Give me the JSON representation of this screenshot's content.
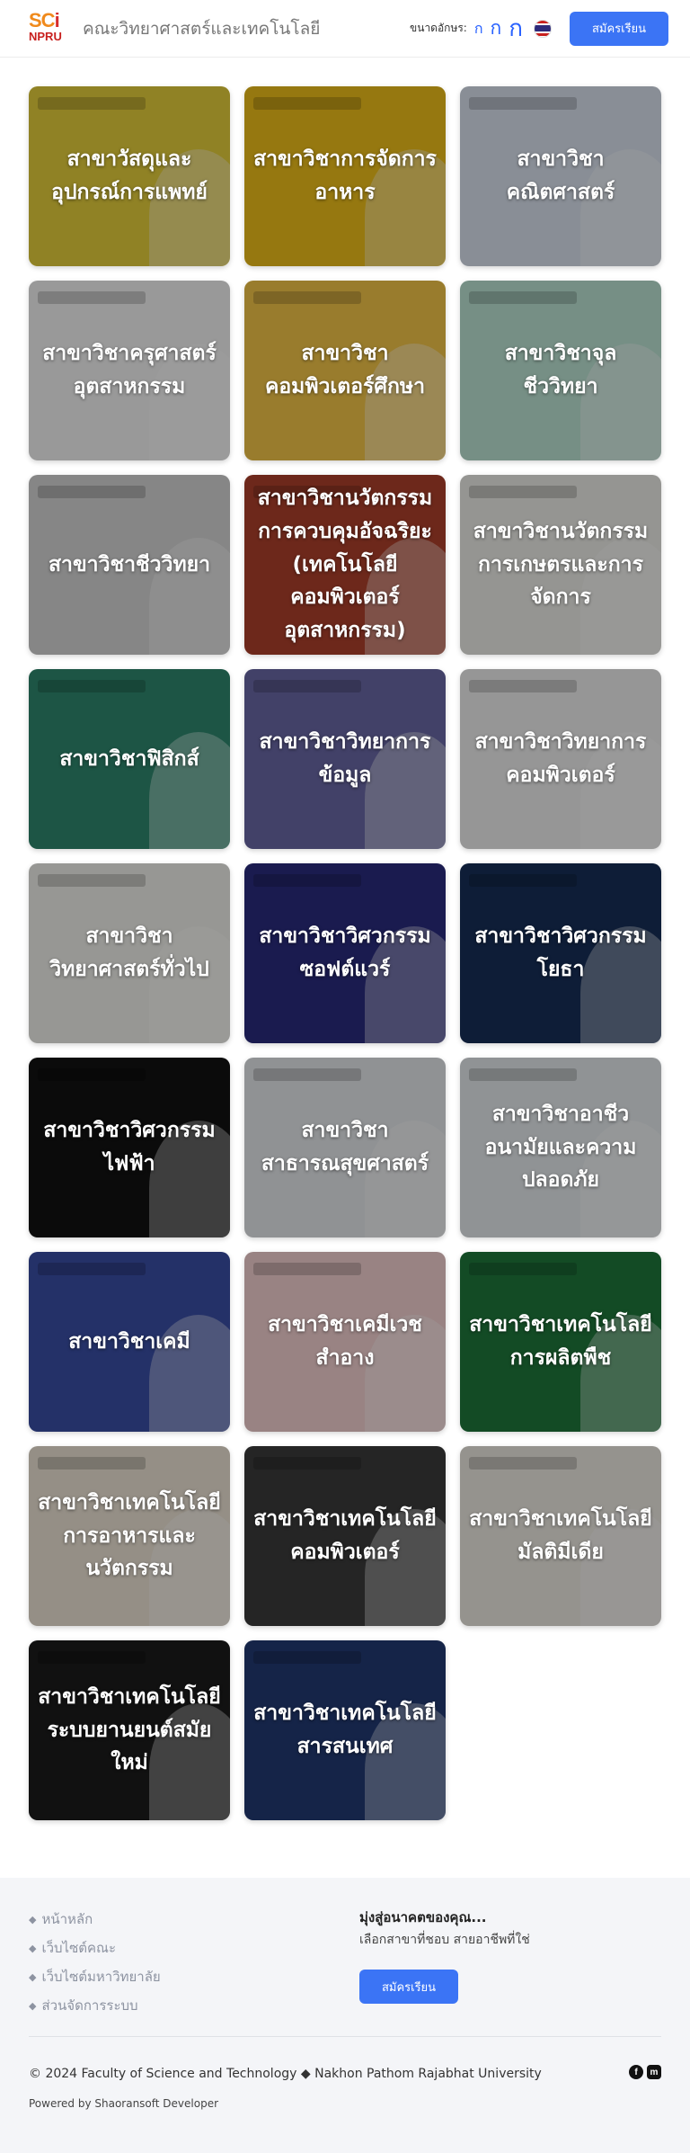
{
  "header": {
    "logo_sc": "SC",
    "logo_i": "i",
    "logo_npru": "NPRU",
    "site_title": "คณะวิทยาศาสตร์และเทคโนโลยี",
    "font_size_label": "ขนาดอักษร:",
    "font_small": "ก",
    "font_medium": "ก",
    "font_large": "ก",
    "language_flag": "thai-flag-icon",
    "apply_button": "สมัครเรียน"
  },
  "colors": {
    "primary": "#3b74f5",
    "link_muted": "#8d93a1",
    "footer_bg": "#f4f5f8"
  },
  "majors": [
    {
      "label": "สาขาวัสดุและอุปกรณ์การแพทย์",
      "bg": "#e9d23c"
    },
    {
      "label": "สาขาวิชาการจัดการอาหาร",
      "bg": "#f2c21b"
    },
    {
      "label": "สาขาวิชาคณิตศาสตร์",
      "bg": "#dde6f3"
    },
    {
      "label": "สาขาวิชาครุศาสตร์อุตสาหกรรม",
      "bg": "#f7f7f7"
    },
    {
      "label": "สาขาวิชาคอมพิวเตอร์ศึกษา",
      "bg": "#f7c84a"
    },
    {
      "label": "สาขาวิชาจุลชีววิทยา",
      "bg": "#bfe7d7"
    },
    {
      "label": "สาขาวิชาชีววิทยา",
      "bg": "#d9d9d9"
    },
    {
      "label": "สาขาวิชานวัตกรรมการควบคุมอัจฉริยะ (เทคโนโลยีคอมพิวเตอร์อุตสาหกรรม)",
      "bg": "#b1422c"
    },
    {
      "label": "สาขาวิชานวัตกรรมการเกษตรและการจัดการ",
      "bg": "#f1f1ec"
    },
    {
      "label": "สาขาวิชาฟิสิกส์",
      "bg": "#2f8a70"
    },
    {
      "label": "สาขาวิชาวิทยาการข้อมูล",
      "bg": "#6b6aa8"
    },
    {
      "label": "สาขาวิชาวิทยาการคอมพิวเตอร์",
      "bg": "#f3f3f3"
    },
    {
      "label": "สาขาวิชาวิทยาศาสตร์ทั่วไป",
      "bg": "#f4f4ef"
    },
    {
      "label": "สาขาวิชาวิศวกรรมซอฟต์แวร์",
      "bg": "#2b2c80"
    },
    {
      "label": "สาขาวิชาวิศวกรรมโยธา",
      "bg": "#17305a"
    },
    {
      "label": "สาขาวิชาวิศวกรรมไฟฟ้า",
      "bg": "#121212"
    },
    {
      "label": "สาขาวิชาสาธารณสุขศาสตร์",
      "bg": "#e8ecef"
    },
    {
      "label": "สาขาวิชาอาชีวอนามัยและความปลอดภัย",
      "bg": "#e9eef1"
    },
    {
      "label": "สาขาวิชาเคมี",
      "bg": "#3b4fa8"
    },
    {
      "label": "สาขาวิชาเคมีเวชสำอาง",
      "bg": "#f7d4d4"
    },
    {
      "label": "สาขาวิชาเทคโนโลยีการผลิตพืช",
      "bg": "#1f7a3d"
    },
    {
      "label": "สาขาวิชาเทคโนโลยีการอาหารและนวัตกรรม",
      "bg": "#f0e7d8"
    },
    {
      "label": "สาขาวิชาเทคโนโลยีคอมพิวเตอร์",
      "bg": "#3c3c3c"
    },
    {
      "label": "สาขาวิชาเทคโนโลยีมัลติมีเดีย",
      "bg": "#f1ede6"
    },
    {
      "label": "สาขาวิชาเทคโนโลยีระบบยานยนต์สมัยใหม่",
      "bg": "#1c1c1c"
    },
    {
      "label": "สาขาวิชาเทคโนโลยีสารสนเทศ",
      "bg": "#233b75"
    }
  ],
  "footer": {
    "links": [
      "หน้าหลัก",
      "เว็บไซต์คณะ",
      "เว็บไซต์มหาวิทยาลัย",
      "ส่วนจัดการระบบ"
    ],
    "cta_title": "มุ่งสู่อนาคตของคุณ...",
    "cta_sub": "เลือกสาขาที่ชอบ สายอาชีพที่ใช่",
    "cta_button": "สมัครเรียน",
    "copyright": "© 2024 Faculty of Science and Technology ◆ Nakhon Pathom Rajabhat University",
    "powered": "Powered by Shaoransoft Developer",
    "social_facebook": "f",
    "social_messenger": "m"
  }
}
